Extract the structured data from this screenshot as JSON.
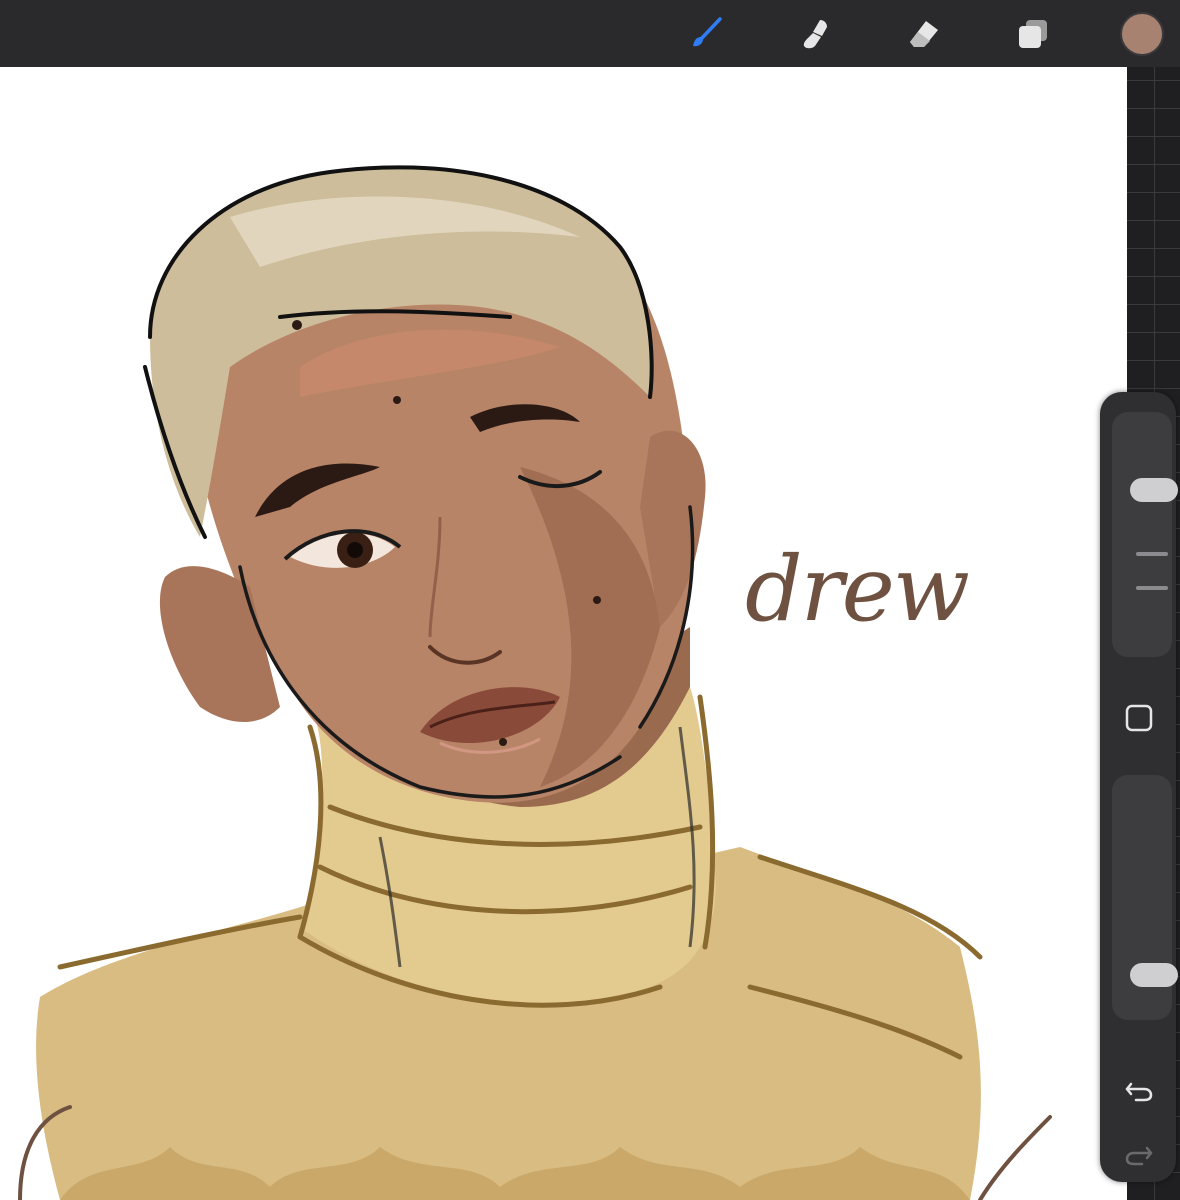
{
  "toolbar": {
    "tools": [
      {
        "name": "brush",
        "icon": "brush-icon",
        "active": true
      },
      {
        "name": "smudge",
        "icon": "smudge-icon",
        "active": false
      },
      {
        "name": "eraser",
        "icon": "eraser-icon",
        "active": false
      },
      {
        "name": "layers",
        "icon": "layers-icon",
        "active": false
      }
    ],
    "current_color": "#a88270",
    "active_color": "#2f7df6"
  },
  "canvas": {
    "signature": "drew"
  },
  "sidebar": {
    "brush_size_fraction": 0.3,
    "opacity_fraction": 0.85,
    "buttons": [
      "modify-square-icon",
      "undo-icon",
      "redo-icon"
    ]
  }
}
